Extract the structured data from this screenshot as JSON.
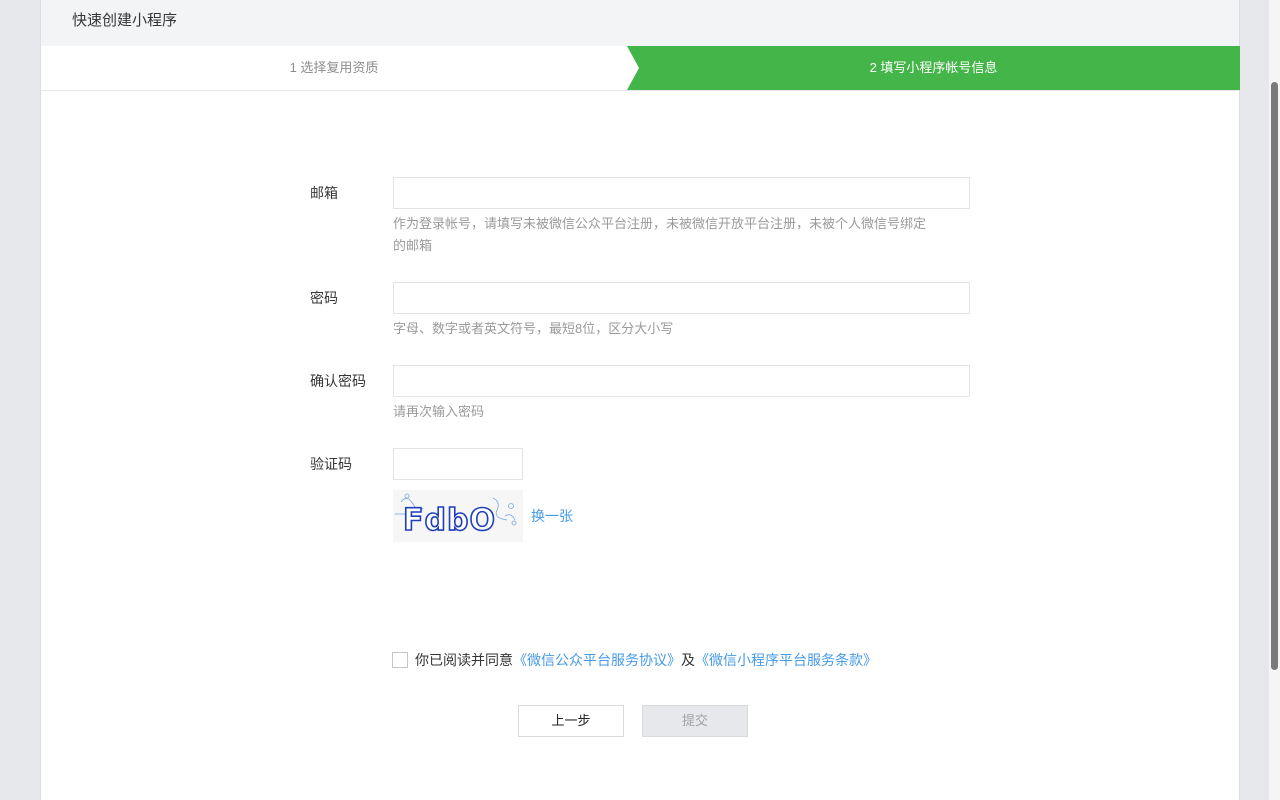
{
  "header": {
    "title": "快速创建小程序"
  },
  "steps": [
    {
      "label": "1 选择复用资质",
      "active": false
    },
    {
      "label": "2 填写小程序帐号信息",
      "active": true
    }
  ],
  "form": {
    "email": {
      "label": "邮箱",
      "value": "",
      "tip_line1": "作为登录帐号，请填写未被微信公众平台注册，未被微信开放平台注册，未被个人微信号绑定",
      "tip_line2": "的邮箱"
    },
    "password": {
      "label": "密码",
      "value": "",
      "tip": "字母、数字或者英文符号，最短8位，区分大小写"
    },
    "confirm": {
      "label": "确认密码",
      "value": "",
      "tip": "请再次输入密码"
    },
    "captcha": {
      "label": "验证码",
      "value": "",
      "image_text": "FdbO",
      "refresh_label": "换一张"
    }
  },
  "agreement": {
    "checked": false,
    "prefix": "你已阅读并同意",
    "link1": "《微信公众平台服务协议》",
    "conjunction": "及",
    "link2": "《微信小程序平台服务条款》"
  },
  "buttons": {
    "prev_label": "上一步",
    "submit_label": "提交"
  },
  "colors": {
    "accent_green": "#44b549",
    "link_blue": "#459ae9",
    "captcha_blue": "#1e3fb8"
  }
}
